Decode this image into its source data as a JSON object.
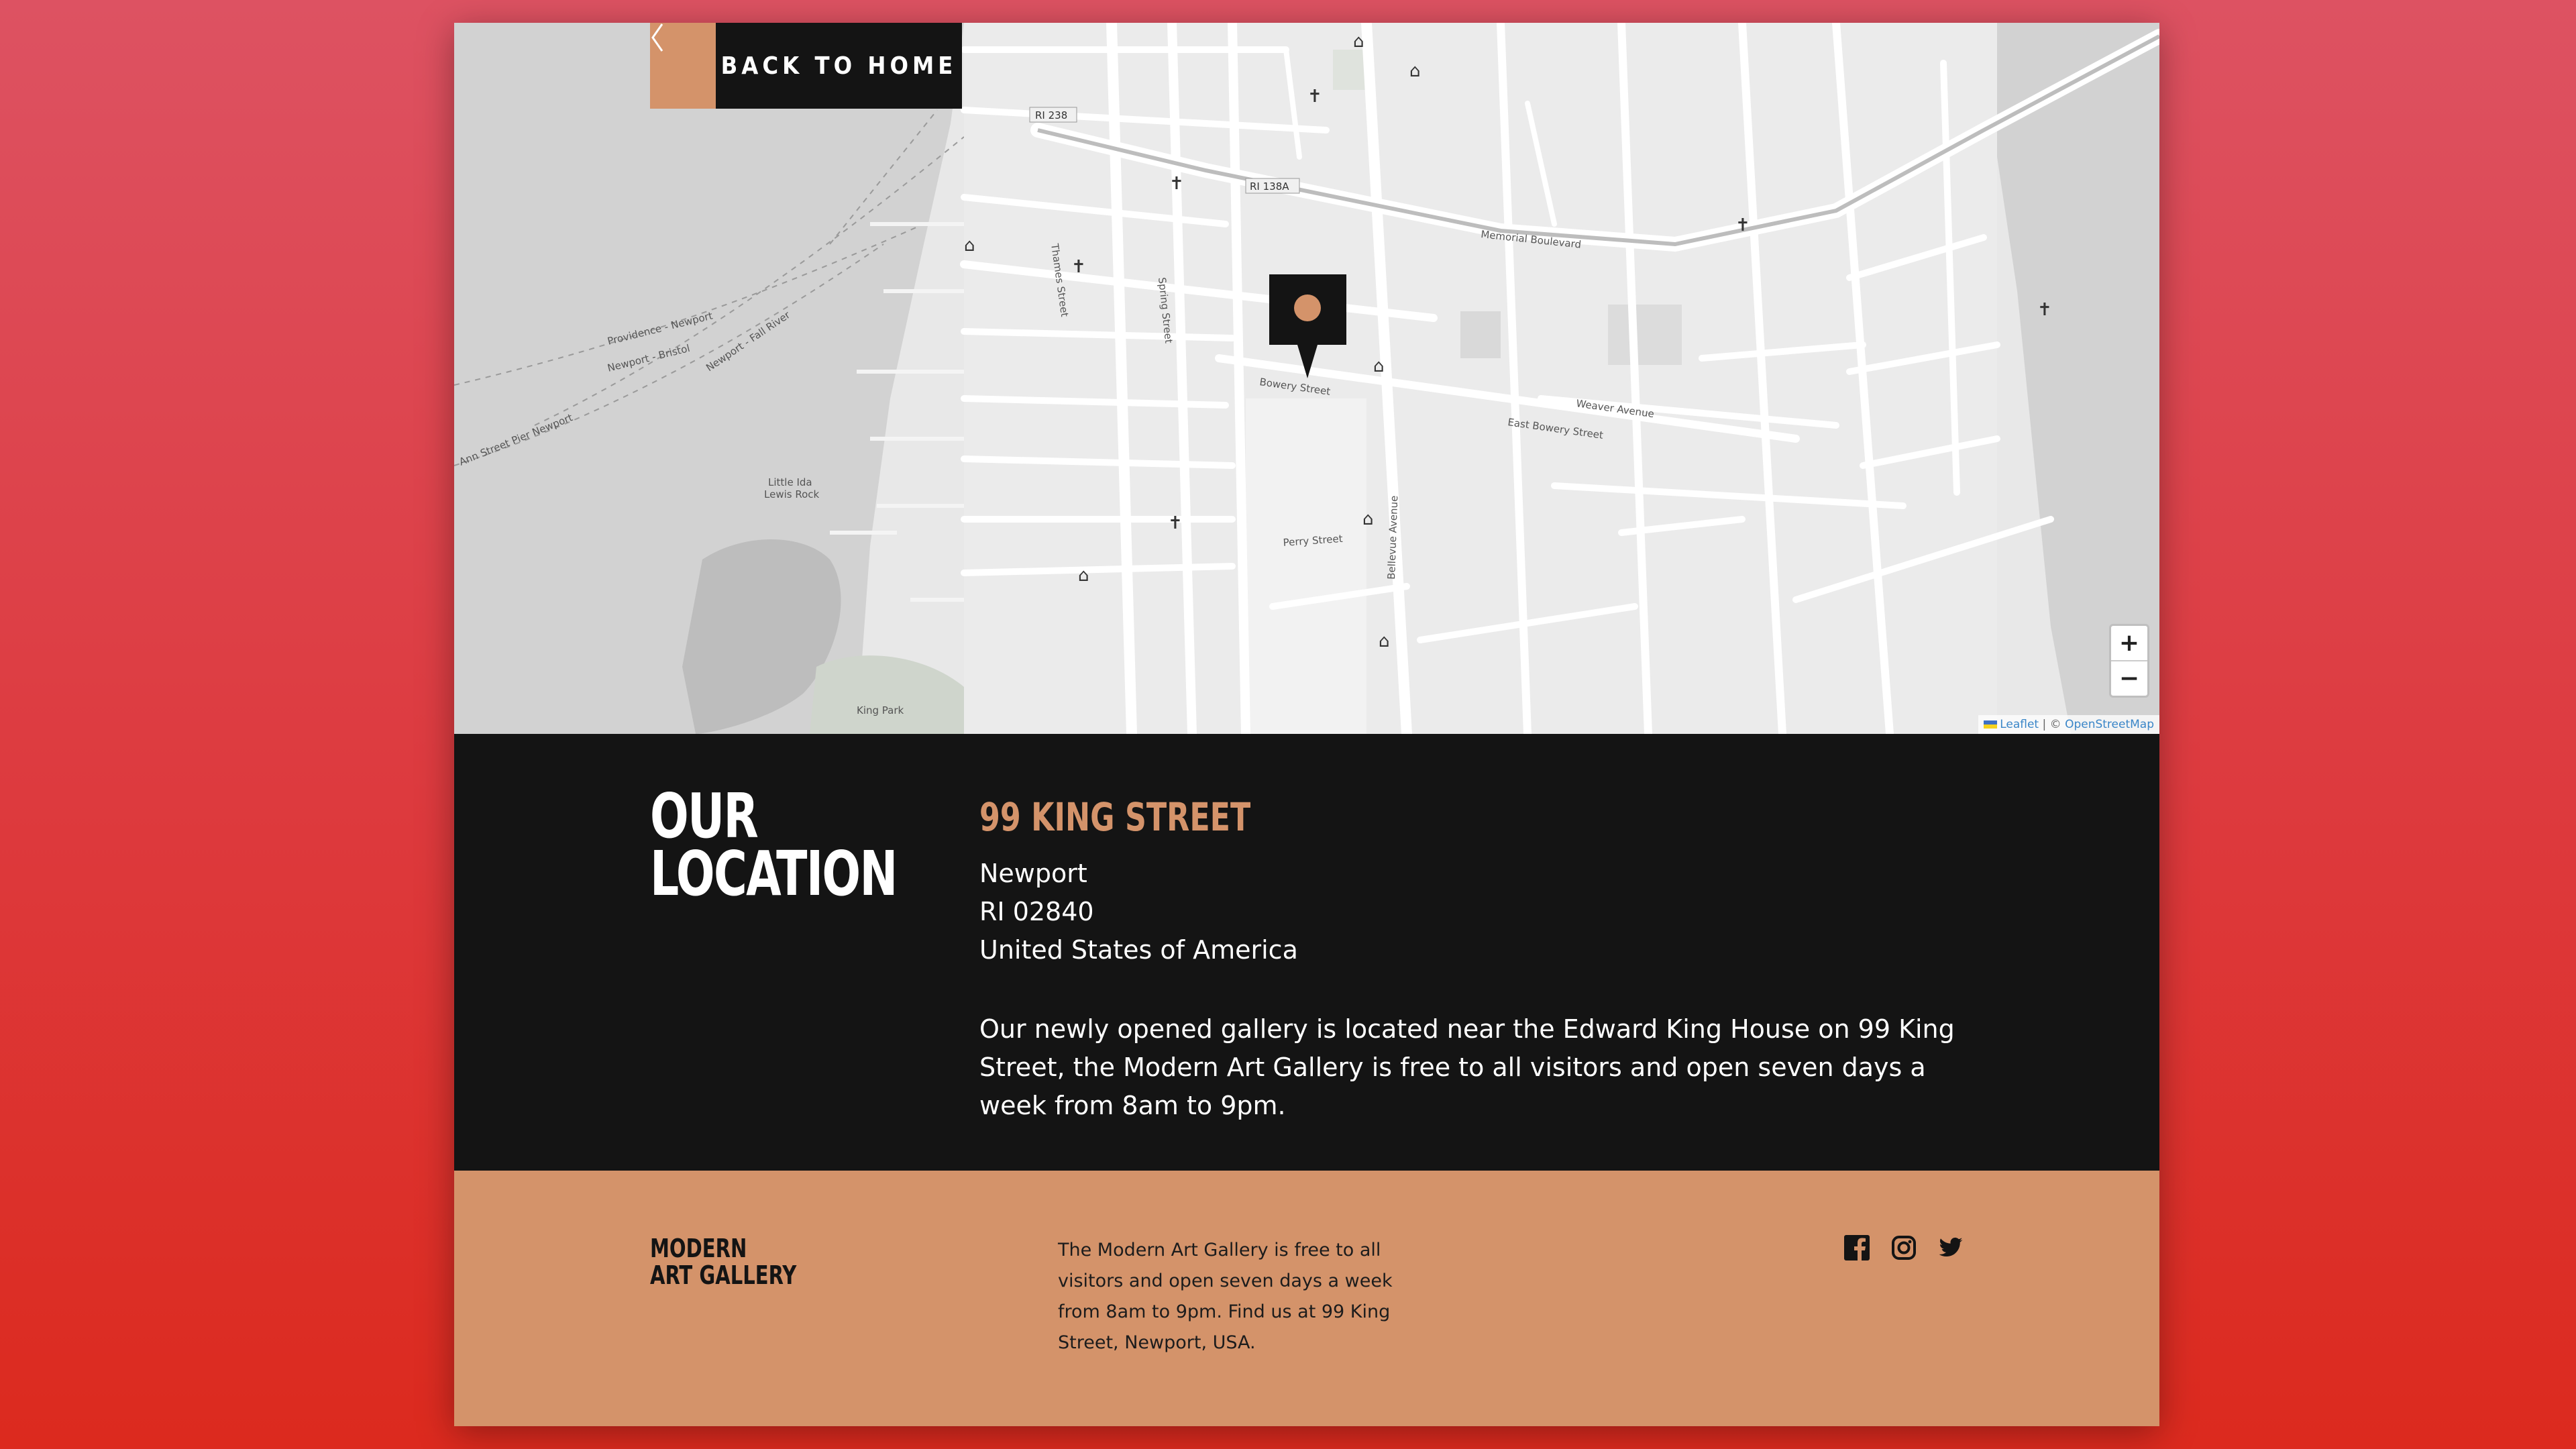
{
  "nav": {
    "back_label": "BACK TO HOME",
    "back_icon": "chevron-left-icon"
  },
  "map": {
    "labels": {
      "providence": "Providence - Newport",
      "newport_bristol": "Newport - Bristol",
      "newport_fall": "Newport - Fall River",
      "ann_pier": "Ann Street Pier Newport",
      "little_ida": "Little Ida",
      "lewis_rock": "Lewis Rock",
      "bowery": "Bowery Street",
      "east_bowery": "East Bowery Street",
      "memorial": "Memorial Boulevard",
      "thames": "Thames Street",
      "spring": "Spring Street",
      "bellevue": "Bellevue Avenue",
      "king_park": "King Park",
      "perry": "Perry Street",
      "weaver": "Weaver Avenue",
      "ri238": "RI 238",
      "ri138a": "RI 138A"
    },
    "zoom_in": "+",
    "zoom_out": "−",
    "attribution_leaflet": "Leaflet",
    "attribution_osm": "OpenStreetMap",
    "attribution_sep": "| ©"
  },
  "location": {
    "title_line1": "OUR",
    "title_line2": "LOCATION",
    "street": "99 KING STREET",
    "city": "Newport",
    "state_zip": "RI 02840",
    "country": "United States of America",
    "description": "Our newly opened gallery is located near the Edward King House on 99 King Street, the Modern Art Gallery is free to all visitors and open seven days a week from 8am to 9pm."
  },
  "footer": {
    "brand_line1": "MODERN",
    "brand_line2": "ART GALLERY",
    "text": "The Modern Art Gallery is free to all visitors and open seven days a week from 8am to 9pm. Find us at 99 King Street, Newport, USA.",
    "socials": [
      "facebook-icon",
      "instagram-icon",
      "twitter-icon"
    ]
  },
  "colors": {
    "accent": "#d4936a",
    "dark": "#141414",
    "bg_top": "#dd5262",
    "bg_bottom": "#dc2a1e"
  }
}
